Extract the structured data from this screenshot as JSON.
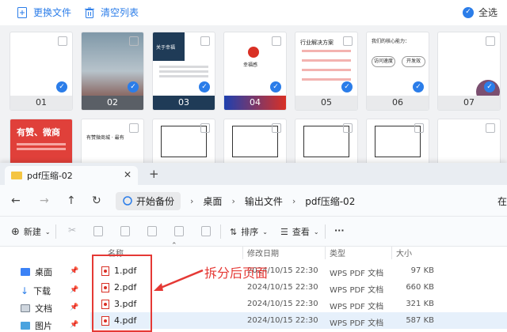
{
  "toolbar_top": {
    "replace_file": "更换文件",
    "clear_list": "清空列表",
    "select_all": "全选"
  },
  "thumbs": [
    {
      "label": "01"
    },
    {
      "label": "02"
    },
    {
      "label": "03"
    },
    {
      "label": "04"
    },
    {
      "label": "05"
    },
    {
      "label": "06"
    },
    {
      "label": "07"
    }
  ],
  "thumb_text": {
    "t2_title": "关于幸福",
    "t4_caption": "幸福感",
    "t5_title": "行业解决方案",
    "t6_title": "我们的核心能力：",
    "t6_box1": "访问速度",
    "t6_box2": "开发效",
    "row2_1_title": "有赞、微商",
    "row2_2_title": "有赞微商城 · 最有"
  },
  "window": {
    "tab_title": "pdf压缩-02",
    "crumbs": [
      "开始备份",
      "桌面",
      "输出文件",
      "pdf压缩-02"
    ],
    "nav_right": "在",
    "new_label": "新建",
    "sort_label": "排序",
    "view_label": "查看",
    "more_label": "···"
  },
  "columns": {
    "name": "名称",
    "date": "修改日期",
    "type": "类型",
    "size": "大小"
  },
  "sidebar": [
    {
      "label": "桌面"
    },
    {
      "label": "下载"
    },
    {
      "label": "文档"
    },
    {
      "label": "图片"
    }
  ],
  "files": [
    {
      "name": "1.pdf",
      "date": "2024/10/15 22:30",
      "type": "WPS PDF 文档",
      "size": "97 KB"
    },
    {
      "name": "2.pdf",
      "date": "2024/10/15 22:30",
      "type": "WPS PDF 文档",
      "size": "660 KB"
    },
    {
      "name": "3.pdf",
      "date": "2024/10/15 22:30",
      "type": "WPS PDF 文档",
      "size": "321 KB"
    },
    {
      "name": "4.pdf",
      "date": "2024/10/15 22:30",
      "type": "WPS PDF 文档",
      "size": "587 KB"
    }
  ],
  "annotation": "拆分后页面",
  "colors": {
    "accent": "#2b7de9",
    "red": "#e53935"
  }
}
